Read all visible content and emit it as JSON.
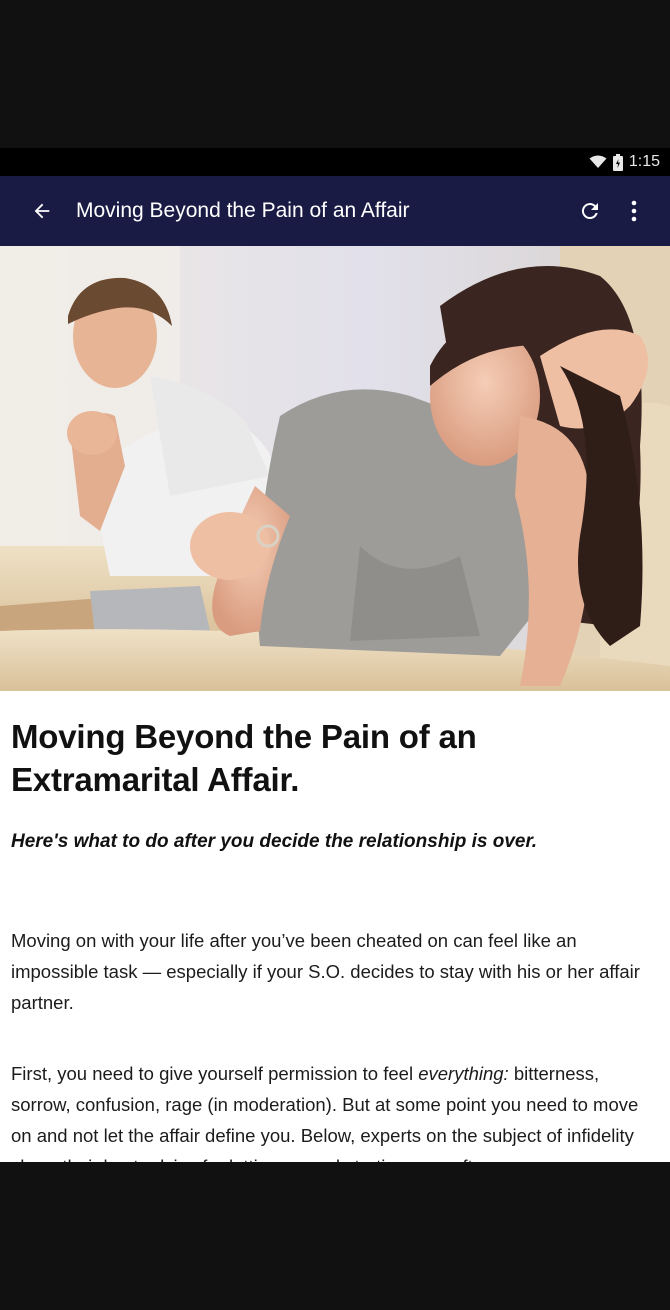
{
  "status_bar": {
    "time": "1:15"
  },
  "app_bar": {
    "title": "Moving Beyond the Pain of an Affair",
    "back_icon": "arrow-back-icon",
    "refresh_icon": "refresh-icon",
    "more_icon": "more-vert-icon"
  },
  "hero_image": {
    "description_icon": "photo"
  },
  "article": {
    "headline": "Moving Beyond the Pain of an Extramarital Affair.",
    "subhead": "Here's what to do after you decide the relationship is over.",
    "para1": "Moving on with your life after you’ve been cheated on can feel like an impossible task — especially if your S.O. decides to stay with his or her affair partner.",
    "para2_before": "First, you need to give yourself permission to feel ",
    "para2_em": "everything:",
    "para2_after": " bitterness, sorrow, confusion, rage (in moderation). But at some point you need to move on and not let the affair define you. Below, experts on the subject of infidelity share their best advice for letting go and starting over after"
  },
  "colors": {
    "app_bar": "#1a1b45",
    "status_bar": "#000000",
    "letterbox": "#111111"
  }
}
